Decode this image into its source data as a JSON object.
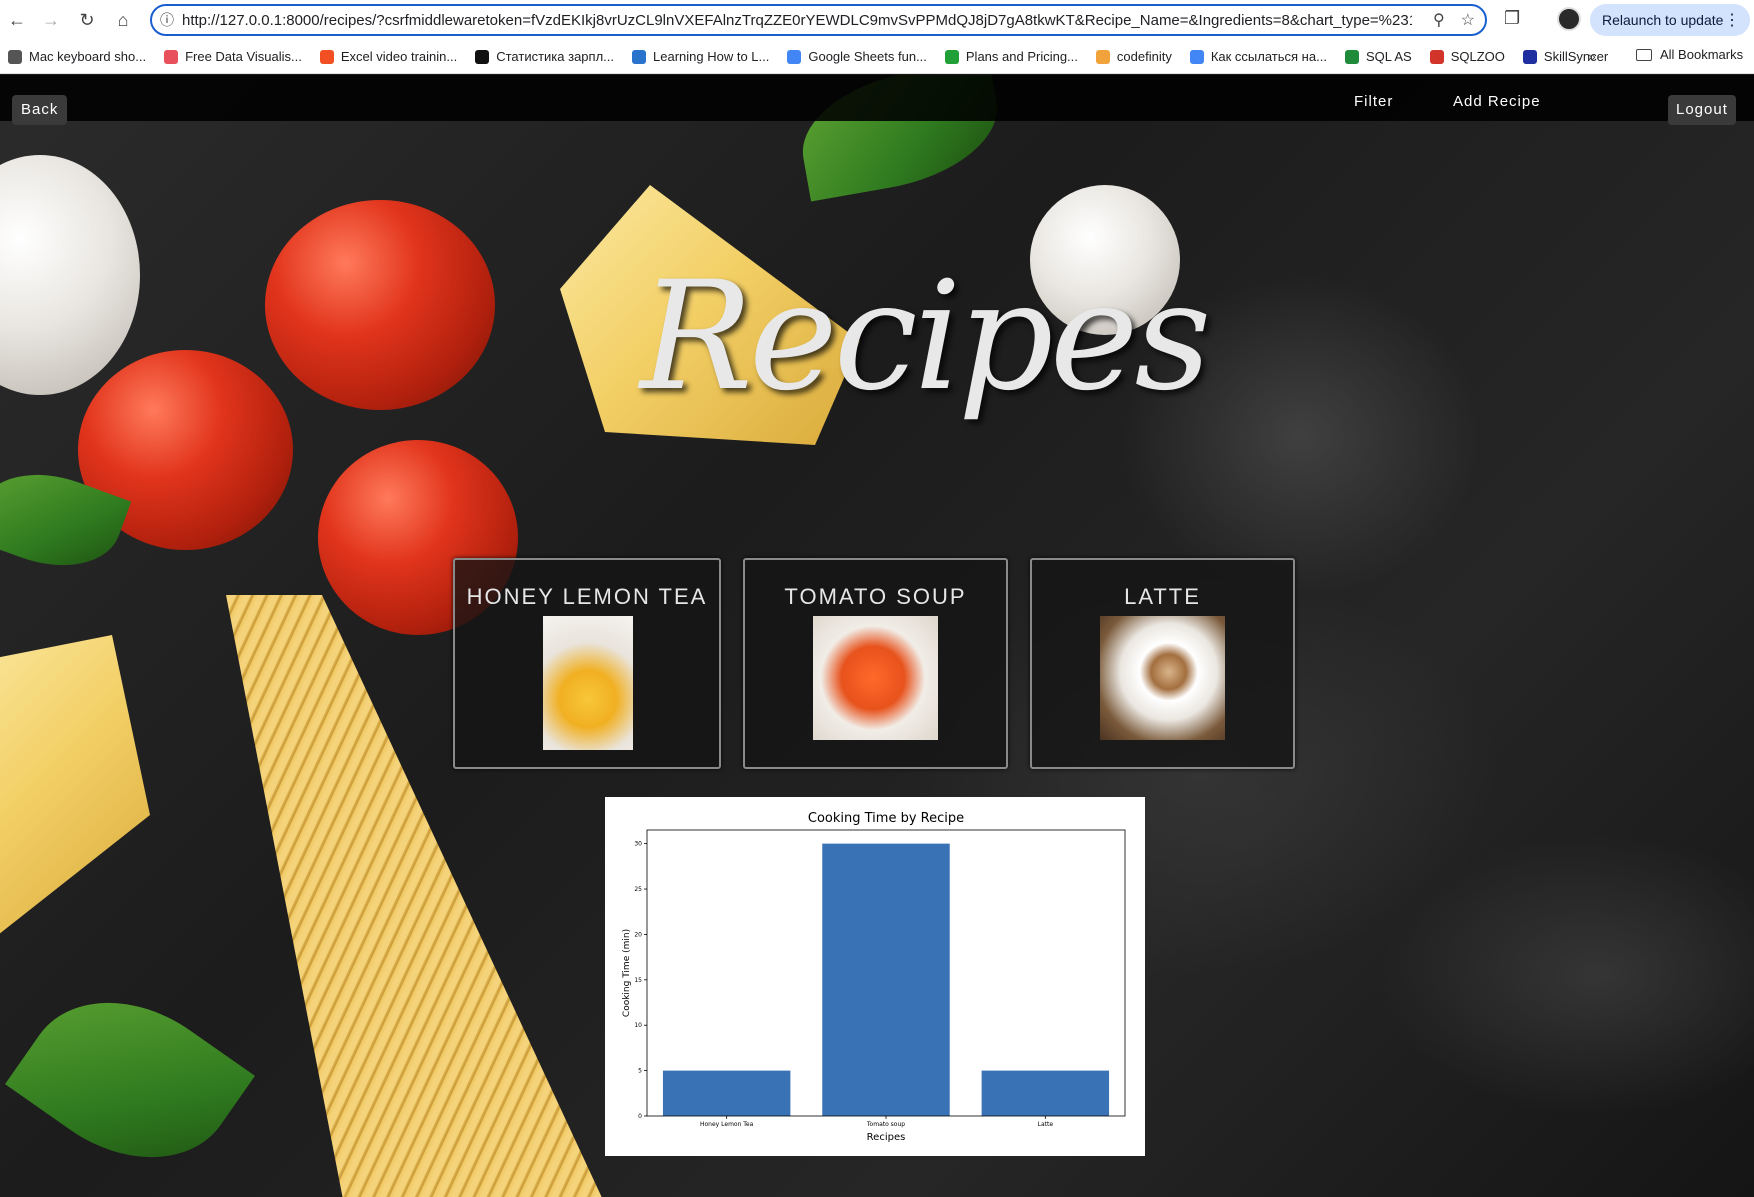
{
  "browser": {
    "url": "http://127.0.0.1:8000/recipes/?csrfmiddlewaretoken=fVzdEKIkj8vrUzCL9lnVXEFAlnzTrqZZE0rYEWDLC9mvSvPPMdQJ8jD7gA8tkwKT&Recipe_Name=&Ingredients=8&chart_type=%231",
    "relaunch_label": "Relaunch to update",
    "bookmarks": [
      {
        "label": "Mac keyboard sho...",
        "color": "#555555"
      },
      {
        "label": "Free Data Visualis...",
        "color": "#e8505b"
      },
      {
        "label": "Excel video trainin...",
        "color": "#f25022"
      },
      {
        "label": "Статистика зарпл...",
        "color": "#111111"
      },
      {
        "label": "Learning How to L...",
        "color": "#2a73cc"
      },
      {
        "label": "Google Sheets fun...",
        "color": "#4285f4"
      },
      {
        "label": "Plans and Pricing...",
        "color": "#21a038"
      },
      {
        "label": "codefinity",
        "color": "#f2a23a"
      },
      {
        "label": "Как ссылаться на...",
        "color": "#4285f4"
      },
      {
        "label": "SQL AS",
        "color": "#1e8a3a"
      },
      {
        "label": "SQLZOO",
        "color": "#d3342a"
      },
      {
        "label": "SkillSyncer",
        "color": "#1f2fa0"
      }
    ],
    "all_bookmarks_label": "All Bookmarks"
  },
  "nav": {
    "back_label": "Back",
    "filter_label": "Filter",
    "add_recipe_label": "Add Recipe",
    "logout_label": "Logout"
  },
  "page_title": "Recipes",
  "recipes": [
    {
      "name": "HONEY LEMON TEA"
    },
    {
      "name": "TOMATO SOUP"
    },
    {
      "name": "LATTE"
    }
  ],
  "chart_data": {
    "type": "bar",
    "title": "Cooking Time by Recipe",
    "xlabel": "Recipes",
    "ylabel": "Cooking Time (min)",
    "categories": [
      "Honey Lemon Tea",
      "Tomato soup",
      "Latte"
    ],
    "values": [
      5,
      30,
      5
    ],
    "ylim": [
      0,
      31.5
    ],
    "yticks": [
      0,
      5,
      10,
      15,
      20,
      25,
      30
    ],
    "bar_color": "#3a73b5",
    "grid": false
  }
}
